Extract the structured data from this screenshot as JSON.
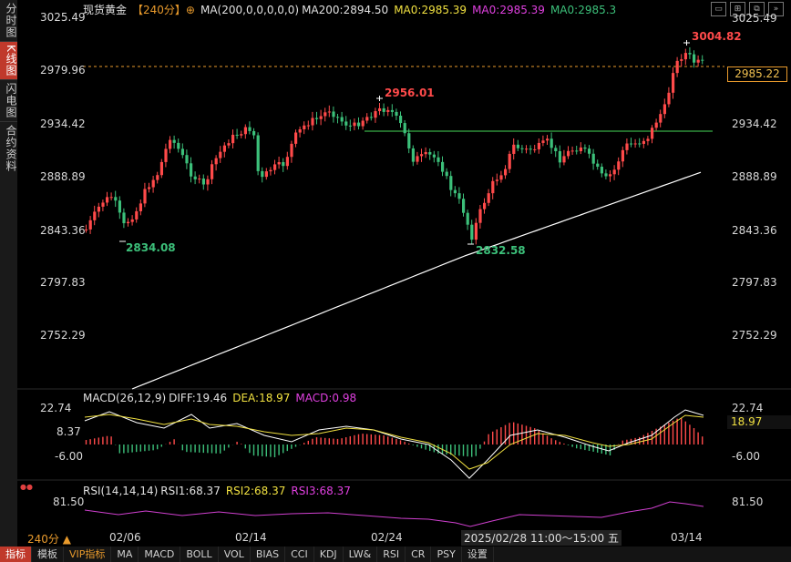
{
  "sidebar": {
    "tabs": [
      {
        "label": "分时图",
        "active": false
      },
      {
        "label": "K线图",
        "active": true
      },
      {
        "label": "闪电图",
        "active": false
      },
      {
        "label": "合约资料",
        "active": false
      }
    ]
  },
  "header": {
    "symbol": "现货黄金",
    "period_tag": "【240分】",
    "ma_main": "MA(200,0,0,0,0,0)",
    "ma200": "MA200:2894.50",
    "ma0_a": "MA0:2985.39",
    "ma0_b": "MA0:2985.39",
    "ma0_c": "MA0:2985.3"
  },
  "window_icons": [
    "window-icon",
    "expand-icon",
    "restore-icon",
    "next-icon"
  ],
  "price_axis": [
    "3025.49",
    "2979.96",
    "2934.42",
    "2888.89",
    "2843.36",
    "2797.83",
    "2752.29"
  ],
  "current_price": "2985.22",
  "annotations": {
    "high": "3004.82",
    "mid_high": "2956.01",
    "low1": "2834.08",
    "low2": "2832.58"
  },
  "macd": {
    "title": "MACD(26,12,9)",
    "diff": "DIFF:19.46",
    "dea": "DEA:18.97",
    "macd": "MACD:0.98",
    "axis": [
      "22.74",
      "8.37",
      "-6.00"
    ],
    "dea_tag": "18.97"
  },
  "rsi": {
    "title": "RSI(14,14,14)",
    "rsi1": "RSI1:68.37",
    "rsi2": "RSI2:68.37",
    "rsi3": "RSI3:68.37",
    "axis": "81.50"
  },
  "x_axis": {
    "period": "240分 ▲",
    "dates": [
      "02/06",
      "02/14",
      "02/24",
      "03/14"
    ],
    "cursor_time": "2025/02/28 11:00～15:00 五"
  },
  "toolbar": [
    "指标",
    "模板",
    "VIP指标",
    "MA",
    "MACD",
    "BOLL",
    "VOL",
    "BIAS",
    "CCI",
    "KDJ",
    "LW&",
    "RSI",
    "CR",
    "PSY",
    "设置"
  ],
  "colors": {
    "up": "#ff4a4a",
    "down": "#3cc07a",
    "ma": "#ffffff",
    "dea": "#f0e040",
    "macd_label": "#e040e0",
    "accent": "#e89a2c"
  }
}
